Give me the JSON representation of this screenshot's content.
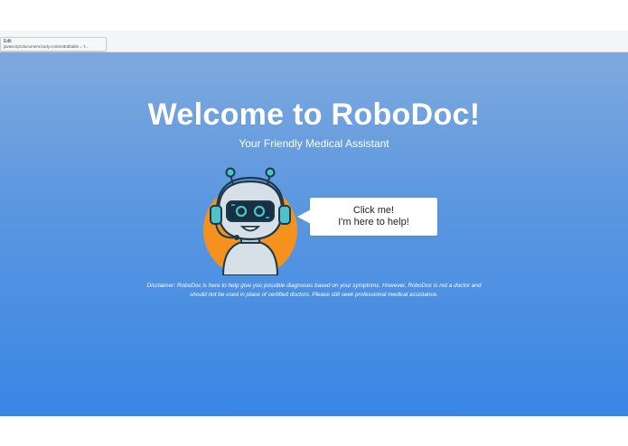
{
  "browser": {
    "tooltip_title": "Edit",
    "tooltip_url": "javascript:document.body.contentEditable = 't..."
  },
  "hero": {
    "title": "Welcome to RoboDoc!",
    "subtitle": "Your Friendly Medical Assistant"
  },
  "bubble": {
    "line1": "Click me!",
    "line2": "I'm here to help!"
  },
  "disclaimer": "Disclaimer: RoboDoc is here to help give you possible diagnoses based on your symptoms. However, RoboDoc is not a doctor and should not be used in place of certified doctors. Please still seek professional medical assistance.",
  "colors": {
    "background_top": "#7fa9dd",
    "background_bottom": "#3a86e4",
    "robot_circle": "#f5921e",
    "robot_accent": "#4cc3cb",
    "robot_body": "#d7e0e6",
    "robot_outline": "#1c3a4a"
  },
  "icons": {
    "robot": "robot-doctor-icon"
  }
}
